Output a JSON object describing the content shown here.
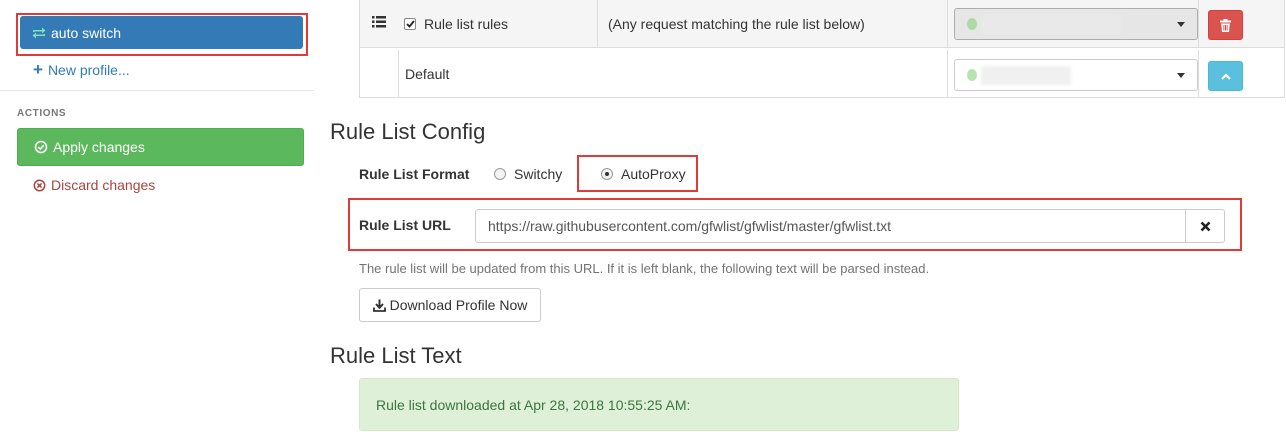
{
  "sidebar": {
    "active_profile": "auto switch",
    "new_profile": "New profile...",
    "actions_heading": "ACTIONS",
    "apply_changes": "Apply changes",
    "discard_changes": "Discard changes"
  },
  "rules_table": {
    "rows": [
      {
        "enabled": true,
        "condition": "Rule list rules",
        "details": "(Any request matching the rule list below)",
        "profile_value": "",
        "action_icon": "trash-icon"
      },
      {
        "condition": "Default",
        "profile_value": "",
        "action_icon": "chevron-up-icon"
      }
    ]
  },
  "rule_list_config": {
    "heading": "Rule List Config",
    "format_label": "Rule List Format",
    "format_options": [
      "Switchy",
      "AutoProxy"
    ],
    "selected_format": "AutoProxy",
    "url_label": "Rule List URL",
    "url_value": "https://raw.githubusercontent.com/gfwlist/gfwlist/master/gfwlist.txt",
    "help_text": "The rule list will be updated from this URL. If it is left blank, the following text will be parsed instead.",
    "download_button": "Download Profile Now"
  },
  "rule_list_text": {
    "heading": "Rule List Text",
    "status_message": "Rule list downloaded at Apr 28, 2018 10:55:25 AM:"
  },
  "colors": {
    "primary": "#337ab7",
    "success": "#5cb85c",
    "danger": "#d9534f",
    "info": "#5bc0de",
    "highlight_box": "#e03b3b"
  }
}
